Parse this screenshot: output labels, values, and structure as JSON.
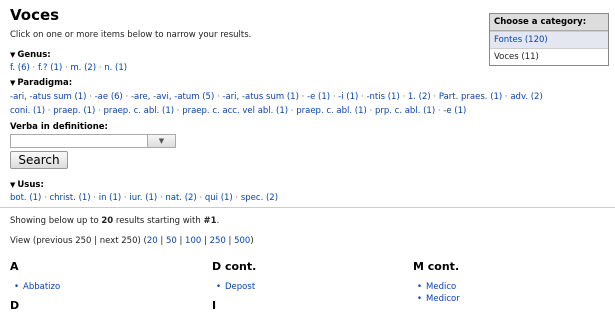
{
  "page_title": "Voces",
  "intro": "Click on one or more items below to narrow your results.",
  "facets": {
    "genus": {
      "label": "Genus:",
      "items": [
        "f. (6)",
        "f.? (1)",
        "m. (2)",
        "n. (1)"
      ]
    },
    "paradigma": {
      "label": "Paradigma:",
      "line1": [
        "-ari, -atus sum (1)",
        "-ae (6)",
        "-are, -avi, -atum (5)",
        "-ari, -atus sum (1)",
        "-e (1)",
        "-i (1)",
        "-ntis (1)",
        "1. (2)",
        "Part. praes. (1)",
        "adv. (2)"
      ],
      "line2": [
        "coni. (1)",
        "praep. (1)",
        "praep. c. abl. (1)",
        "praep. c. acc. vel abl. (1)",
        "praep. c. abl. (1)",
        "prp. c. abl. (1)",
        "-e (1)"
      ]
    },
    "usus": {
      "label": "Usus:",
      "items": [
        "bot. (1)",
        "christ. (1)",
        "in (1)",
        "iur. (1)",
        "nat. (2)",
        "qui (1)",
        "spec. (2)"
      ]
    }
  },
  "verba": {
    "label": "Verba in definitione:",
    "value": ""
  },
  "search_button": "Search",
  "showing": {
    "prefix": "Showing below up to ",
    "count": "20",
    "middle": " results starting with ",
    "start": "#1",
    "suffix": "."
  },
  "view": {
    "prefix": "View (previous 250 | next 250) (",
    "options": [
      "20",
      "50",
      "100",
      "250",
      "500"
    ],
    "suffix": ")"
  },
  "columns": [
    {
      "heading": "A",
      "items": [
        "Abbatizo"
      ],
      "next_heading": "D"
    },
    {
      "heading": "D cont.",
      "items": [
        "Depost"
      ],
      "next_heading": "I"
    },
    {
      "heading": "M cont.",
      "items": [
        "Medico",
        "Medicor"
      ]
    }
  ],
  "category_box": {
    "header": "Choose a category:",
    "items": [
      {
        "label": "Fontes (120)",
        "selected": true
      },
      {
        "label": "Voces (11)",
        "selected": false
      }
    ]
  }
}
